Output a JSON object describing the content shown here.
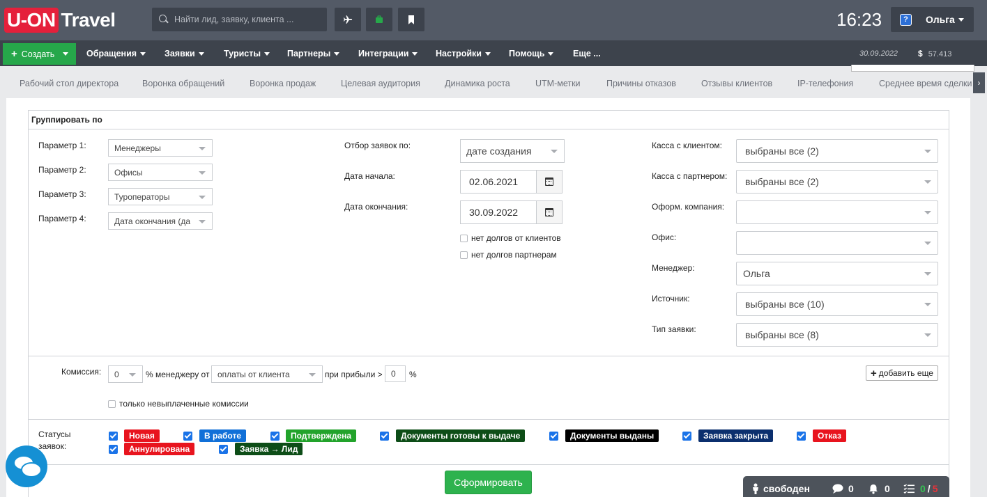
{
  "header": {
    "logo_left": "U-ON",
    "logo_right": "Travel",
    "search_placeholder": "Найти лид, заявку, клиента ...",
    "clock": "16:23",
    "user_name": "Ольга",
    "help_glyph": "?"
  },
  "menu": {
    "create_label": "Создать",
    "items": [
      "Обращения",
      "Заявки",
      "Туристы",
      "Партнеры",
      "Интеграции",
      "Настройки",
      "Помощь",
      "Еще ..."
    ],
    "date": "30.09.2022",
    "currency": "$",
    "balance": "57.413"
  },
  "tabs": [
    "Рабочий стол директора",
    "Воронка обращений",
    "Воронка продаж",
    "Целевая аудитория",
    "Динамика роста",
    "UTM-метки",
    "Причины отказов",
    "Отзывы клиентов",
    "IP-телефония",
    "Среднее время сделки"
  ],
  "group": {
    "title": "Группировать по",
    "params": [
      {
        "label": "Параметр 1:",
        "value": "Менеджеры"
      },
      {
        "label": "Параметр 2:",
        "value": "Офисы"
      },
      {
        "label": "Параметр 3:",
        "value": "Туроператоры"
      },
      {
        "label": "Параметр 4:",
        "value": "Дата окончания (да"
      }
    ]
  },
  "filter": {
    "select_by_label": "Отбор заявок по:",
    "select_by_value": "дате создания",
    "start_label": "Дата начала:",
    "start_value": "02.06.2021",
    "end_label": "Дата окончания:",
    "end_value": "30.09.2022",
    "no_client_debts": "нет долгов от клиентов",
    "no_partner_debts": "нет долгов партнерам"
  },
  "right_filters": [
    {
      "label": "Касса с клиентом:",
      "value": "выбраны все (2)"
    },
    {
      "label": "Касса с партнером:",
      "value": "выбраны все (2)"
    },
    {
      "label": "Оформ. компания:",
      "value": ""
    },
    {
      "label": "Офис:",
      "value": ""
    },
    {
      "label": "Менеджер:",
      "value": "Ольга"
    },
    {
      "label": "Источник:",
      "value": "выбраны все (10)"
    },
    {
      "label": "Тип заявки:",
      "value": "выбраны все (8)"
    }
  ],
  "commission": {
    "label": "Комиссия:",
    "percent": "0",
    "text1": "% менеджеру от",
    "source": "оплаты от клиента",
    "text2": "при прибыли >",
    "profit": "0",
    "text3": "%",
    "add_more": "добавить еще",
    "unpaid_only": "только невыплаченные комиссии"
  },
  "statuses": {
    "label_line1": "Статусы",
    "label_line2": "заявок:",
    "items": [
      {
        "label": "Новая",
        "color": "#e8141e"
      },
      {
        "label": "В работе",
        "color": "#1170d8"
      },
      {
        "label": "Подтверждена",
        "color": "#22a32b"
      },
      {
        "label": "Документы готовы к выдаче",
        "color": "#0d4d17"
      },
      {
        "label": "Документы выданы",
        "color": "#000000"
      },
      {
        "label": "Заявка закрыта",
        "color": "#0b2f6e"
      },
      {
        "label": "Отказ",
        "color": "#e8141e"
      },
      {
        "label": "Аннулирована",
        "color": "#e8141e"
      },
      {
        "label": "Заявка → Лид",
        "color": "#0d4d17"
      }
    ]
  },
  "submit_label": "Сформировать",
  "status_bar": {
    "state": "свободен",
    "messages": "0",
    "notifications": "0",
    "tasks_done": "0",
    "tasks_sep": "/",
    "tasks_total": "5"
  },
  "colors": {
    "brand_red": "#e5203b",
    "create_green": "#26a74a",
    "submit_green": "#2eb24e",
    "topbar": "#535a66",
    "menubar": "#3d434c"
  }
}
